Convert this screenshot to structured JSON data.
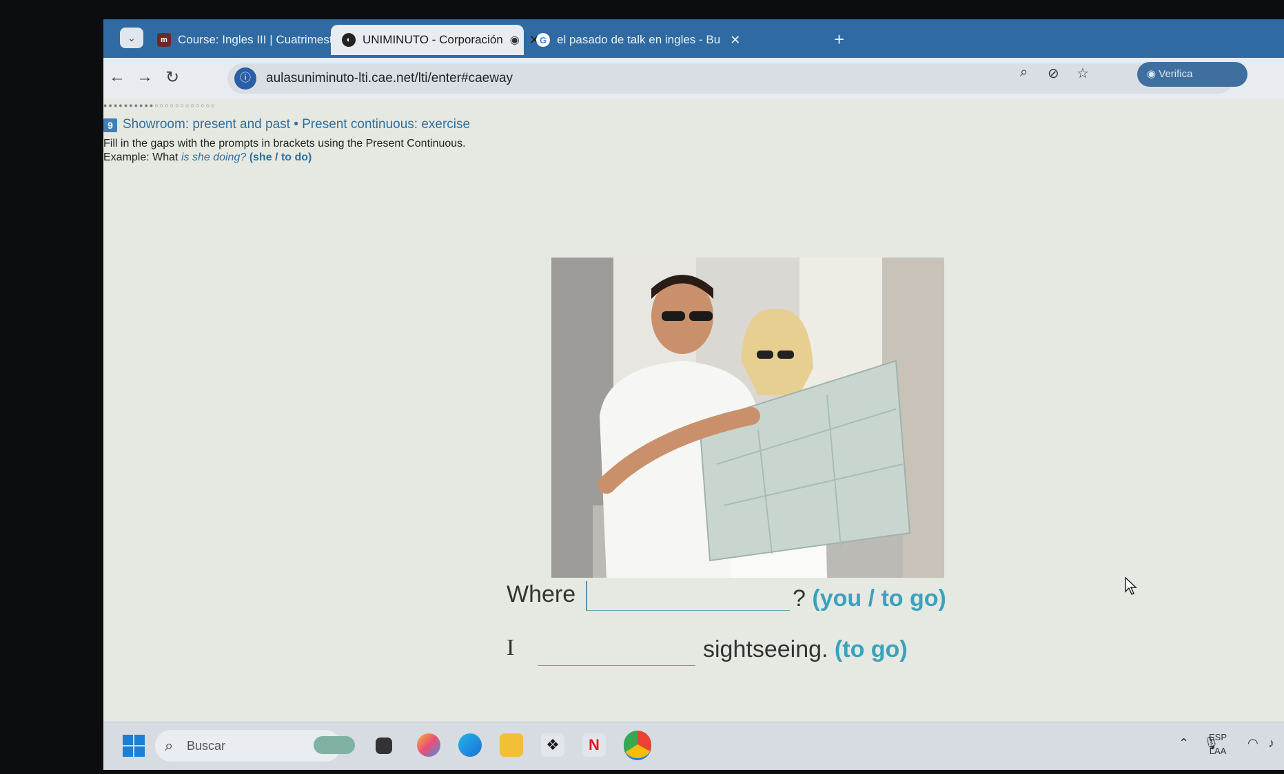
{
  "browser": {
    "tabs": [
      {
        "title": "Course: Ingles III | Cuatrimestral",
        "favicon": "course-logo-icon",
        "active": false
      },
      {
        "title": "UNIMINUTO - Corporación",
        "favicon": "uniminuto-logo-icon",
        "active": true
      },
      {
        "title": "el pasado de talk en ingles - Bu",
        "favicon": "google-g-icon",
        "active": false
      }
    ],
    "address_bar": {
      "url": "aulasuniminuto-lti.cae.net/lti/enter#caeway"
    },
    "verify_label": "Verifica"
  },
  "exercise": {
    "number": "9",
    "title": "Showroom: present and past • Present continuous: exercise",
    "instructions": "Fill in the gaps with the prompts in brackets using the Present Continuous.",
    "example": {
      "label": "Example:",
      "question": "What",
      "answer": "is she doing?",
      "prompt": "(she / to do)"
    },
    "image": "couple-reading-map-photo",
    "questions": [
      {
        "before": "Where",
        "after": "?",
        "prompt": "(you / to go)",
        "value": ""
      },
      {
        "before": "I",
        "after": "sightseeing.",
        "prompt": "(to go)",
        "value": ""
      }
    ]
  },
  "taskbar": {
    "search_placeholder": "Buscar",
    "language": "ESP",
    "layout": "LAA"
  },
  "colors": {
    "accent": "#2f6f9f",
    "prompt": "#3aa2bd",
    "tabstrip": "#2f6aa3"
  }
}
